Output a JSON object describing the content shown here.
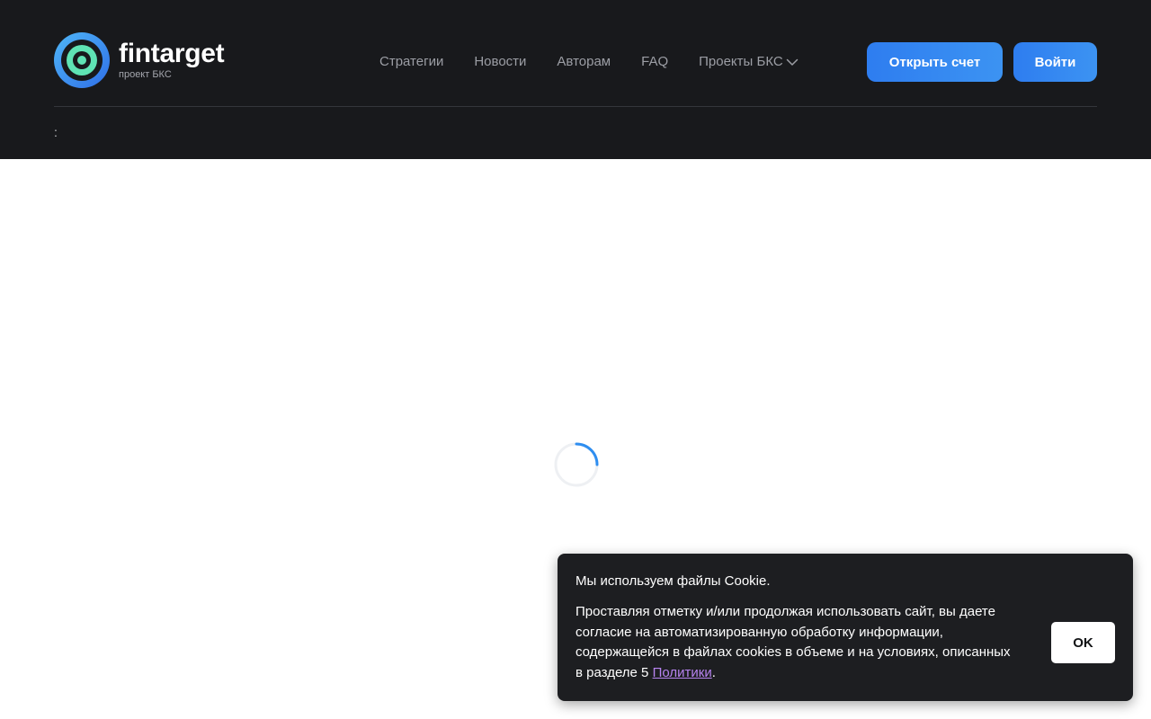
{
  "header": {
    "logo": {
      "name": "fintarget",
      "sub": "проект БКС"
    },
    "nav": [
      {
        "label": "Стратегии"
      },
      {
        "label": "Новости"
      },
      {
        "label": "Авторам"
      },
      {
        "label": "FAQ"
      },
      {
        "label": "Проекты БКС",
        "icon": "chevron-down-icon"
      }
    ],
    "open_account_label": "Открыть счет",
    "login_label": "Войти",
    "breadcrumb": ":"
  },
  "main": {
    "loading_icon": "spinner-icon"
  },
  "cookie_banner": {
    "title": "Мы используем файлы Cookie.",
    "body_prefix": "Проставляя отметку и/или продолжая использовать сайт, вы даете согласие на автоматизированную обработку информации, содержащейся в файлах cookies в объеме и на условиях, описанных в разделе 5 ",
    "link_label": "Политики",
    "body_suffix": ".",
    "ok_label": "OK"
  },
  "colors": {
    "header_bg": "#18191c",
    "accent_blue": "#2e7df0",
    "logo_green": "#5fe3b4",
    "link_purple": "#b783f0"
  }
}
